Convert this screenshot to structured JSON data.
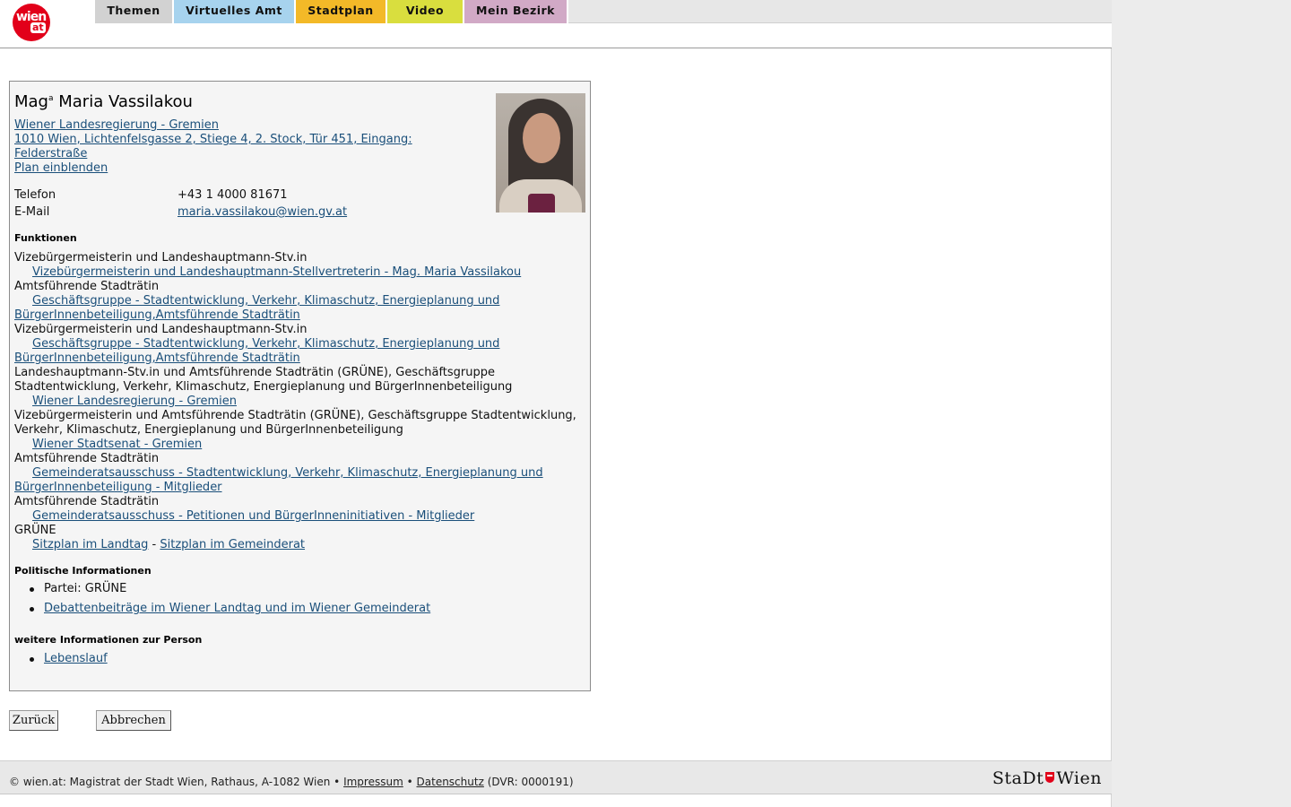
{
  "header": {
    "logo_text": "wien",
    "logo_suffix": "at",
    "tabs": [
      {
        "label": "Themen",
        "color": "#d2d2d2"
      },
      {
        "label": "Virtuelles Amt",
        "color": "#a7d3ee"
      },
      {
        "label": "Stadtplan",
        "color": "#f3b928"
      },
      {
        "label": "Video",
        "color": "#d9de3e"
      },
      {
        "label": "Mein Bezirk",
        "color": "#d1a9c6"
      }
    ]
  },
  "person": {
    "title_prefix": "Mag",
    "title_sup": "a",
    "name": "Maria Vassilakou",
    "org_link": "Wiener Landesregierung - Gremien",
    "address_line1": "1010 Wien, Lichtenfelsgasse 2, Stiege 4, 2. Stock, Tür 451, Eingang:",
    "address_line2": "Felderstraße",
    "plan_link": "Plan einblenden",
    "phone_label": "Telefon",
    "phone_value": "+43 1 4000 81671",
    "email_label": "E-Mail",
    "email_value": "maria.vassilakou@wien.gv.at"
  },
  "funktionen": {
    "title": "Funktionen",
    "entries": [
      {
        "label": "Vizebürgermeisterin und Landeshauptmann-Stv.in",
        "link": "Vizebürgermeisterin und Landeshauptmann-Stellvertreterin - Mag. Maria Vassilakou"
      },
      {
        "label": "Amtsführende Stadträtin",
        "link": "Geschäftsgruppe - Stadtentwicklung, Verkehr, Klimaschutz, Energieplanung und BürgerInnenbeteiligung,Amtsführende Stadträtin"
      },
      {
        "label": "Vizebürgermeisterin und Landeshauptmann-Stv.in",
        "link": "Geschäftsgruppe - Stadtentwicklung, Verkehr, Klimaschutz, Energieplanung und BürgerInnenbeteiligung,Amtsführende Stadträtin"
      },
      {
        "label": "Landeshauptmann-Stv.in und Amtsführende Stadträtin (GRÜNE), Geschäftsgruppe Stadtentwicklung, Verkehr, Klimaschutz, Energieplanung und BürgerInnenbeteiligung",
        "link": "Wiener Landesregierung - Gremien"
      },
      {
        "label": "Vizebürgermeisterin und Amtsführende Stadträtin (GRÜNE), Geschäftsgruppe Stadtentwicklung, Verkehr, Klimaschutz, Energieplanung und BürgerInnenbeteiligung",
        "link": "Wiener Stadtsenat - Gremien"
      },
      {
        "label": "Amtsführende Stadträtin",
        "link": "Gemeinderatsausschuss - Stadtentwicklung, Verkehr, Klimaschutz, Energieplanung und BürgerInnenbeteiligung - Mitglieder"
      },
      {
        "label": "Amtsführende Stadträtin",
        "link": "Gemeinderatsausschuss - Petitionen und BürgerInneninitiativen - Mitglieder"
      }
    ],
    "last_label": "GRÜNE",
    "seat_link_1": "Sitzplan im Landtag",
    "seat_sep": " - ",
    "seat_link_2": "Sitzplan im Gemeinderat"
  },
  "politisch": {
    "title": "Politische Informationen",
    "party": "Partei: GRÜNE",
    "debate_link": "Debattenbeiträge im Wiener Landtag und im Wiener Gemeinderat"
  },
  "weitere": {
    "title": "weitere Informationen zur Person",
    "cv_link": "Lebenslauf"
  },
  "buttons": {
    "back": "Zurück",
    "cancel": "Abbrechen"
  },
  "footer": {
    "copyright": "© wien.at: Magistrat der Stadt Wien, Rathaus, A-1082 Wien •",
    "impressum": "Impressum",
    "bullet": "•",
    "datenschutz": "Datenschutz",
    "dvr": "(DVR: 0000191)",
    "logo_part1": "StaDt",
    "logo_part2": "Wien"
  },
  "colors": {
    "link": "#1a4f7a",
    "brand_red": "#e2001a"
  }
}
